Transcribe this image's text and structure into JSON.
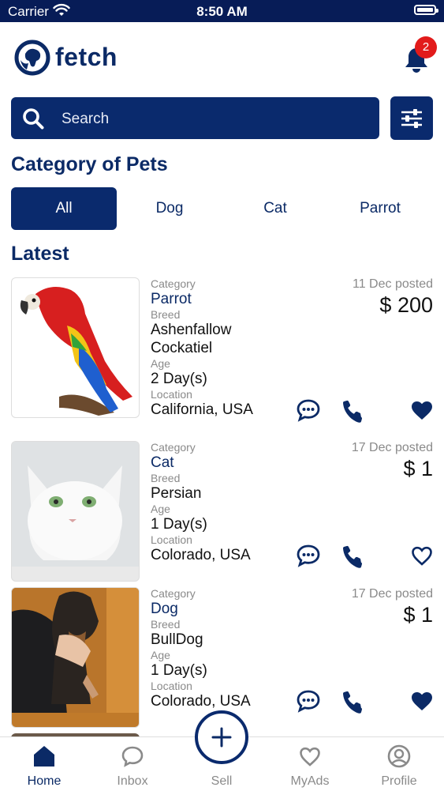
{
  "status_bar": {
    "carrier": "Carrier",
    "time": "8:50 AM"
  },
  "app": {
    "name": "fetch",
    "notification_count": "2"
  },
  "search": {
    "placeholder": "Search"
  },
  "categories_title": "Category of Pets",
  "category_tabs": [
    {
      "label": "All",
      "active": true
    },
    {
      "label": "Dog",
      "active": false
    },
    {
      "label": "Cat",
      "active": false
    },
    {
      "label": "Parrot",
      "active": false
    }
  ],
  "latest_title": "Latest",
  "listing_labels": {
    "category": "Category",
    "breed": "Breed",
    "age": "Age",
    "location": "Location"
  },
  "listings": [
    {
      "category": "Parrot",
      "breed_line1": "Ashenfallow",
      "breed_line2": "Cockatiel",
      "age": "2 Day(s)",
      "location": "California, USA",
      "posted": "11 Dec posted",
      "price": "$ 200",
      "favorited": true
    },
    {
      "category": "Cat",
      "breed_line1": "Persian",
      "age": "1 Day(s)",
      "location": "Colorado, USA",
      "posted": "17 Dec posted",
      "price": "$ 1",
      "favorited": false
    },
    {
      "category": "Dog",
      "breed_line1": "BullDog",
      "age": "1 Day(s)",
      "location": "Colorado, USA",
      "posted": "17 Dec posted",
      "price": "$ 1",
      "favorited": true
    }
  ],
  "bottom_nav": [
    {
      "label": "Home",
      "icon": "home-icon",
      "active": true
    },
    {
      "label": "Inbox",
      "icon": "chat-bubble-icon",
      "active": false
    },
    {
      "label": "Sell",
      "icon": "plus-icon",
      "active": false
    },
    {
      "label": "MyAds",
      "icon": "heart-icon",
      "active": false
    },
    {
      "label": "Profile",
      "icon": "profile-icon",
      "active": false
    }
  ],
  "colors": {
    "primary": "#0a2a6d",
    "badge": "#e21b1b",
    "muted": "#8a8a8a"
  }
}
